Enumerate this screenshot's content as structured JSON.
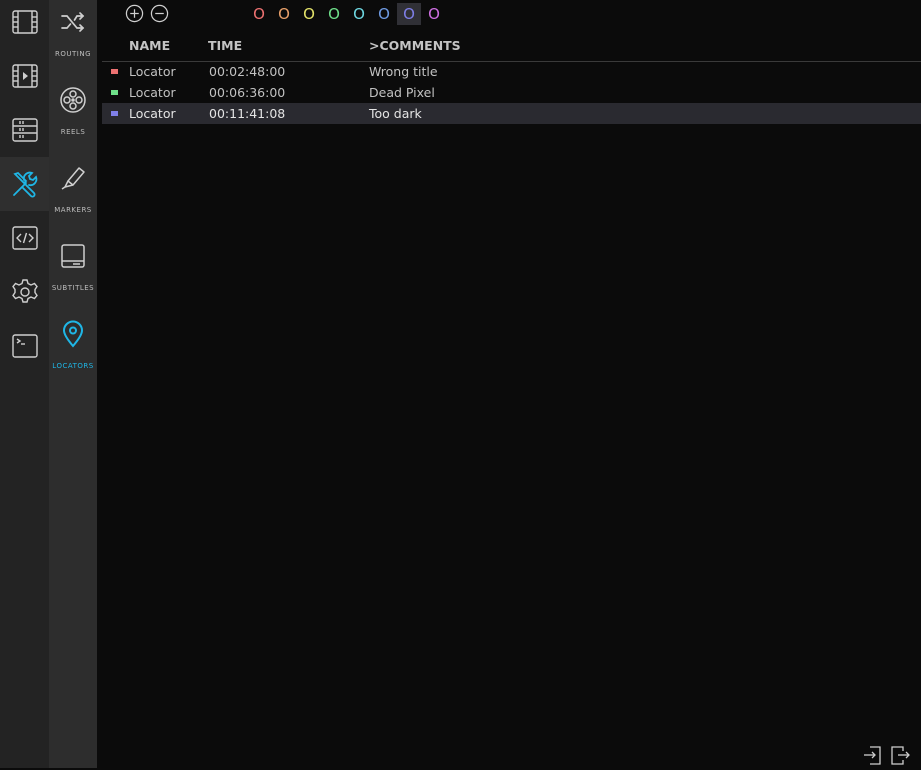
{
  "accent": "#1fb6e6",
  "rail": {
    "items": [
      {
        "icon": "film-icon"
      },
      {
        "icon": "film-play-icon"
      },
      {
        "icon": "storage-icon"
      },
      {
        "icon": "tools-icon",
        "active": true
      },
      {
        "icon": "code-icon"
      },
      {
        "icon": "gear-icon"
      },
      {
        "icon": "terminal-icon"
      }
    ]
  },
  "subpanel": {
    "items": [
      {
        "label": "ROUTING",
        "icon": "shuffle-icon"
      },
      {
        "label": "REELS",
        "icon": "reel-icon"
      },
      {
        "label": "MARKERS",
        "icon": "marker-pen-icon"
      },
      {
        "label": "SUBTITLES",
        "icon": "subtitles-icon"
      },
      {
        "label": "LOCATORS",
        "icon": "location-pin-icon",
        "active": true
      }
    ]
  },
  "toolbar": {
    "color_glyph": "O",
    "colors": [
      "#ee7272",
      "#e9a06a",
      "#e4e36a",
      "#6fe08a",
      "#6fd9e3",
      "#6f9be3",
      "#7f7fe8",
      "#d06fe3"
    ],
    "selected_color_index": 6
  },
  "table": {
    "columns": {
      "name": "NAME",
      "time": "TIME",
      "comments": ">COMMENTS"
    },
    "rows": [
      {
        "color": "#ee7272",
        "name": "Locator",
        "time": "00:02:48:00",
        "comment": "Wrong title"
      },
      {
        "color": "#6fe08a",
        "name": "Locator",
        "time": "00:06:36:00",
        "comment": "Dead Pixel"
      },
      {
        "color": "#7f7fe8",
        "name": "Locator",
        "time": "00:11:41:08",
        "comment": "Too dark",
        "selected": true
      }
    ]
  }
}
